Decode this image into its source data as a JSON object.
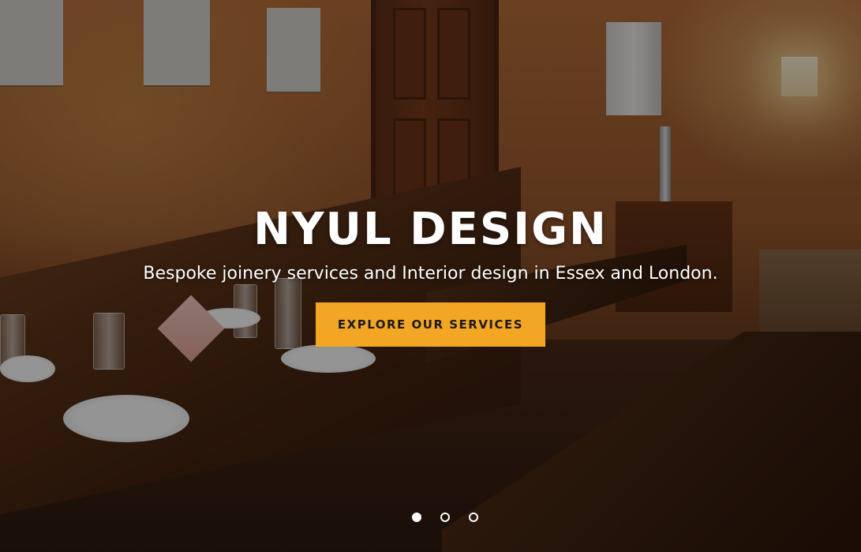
{
  "hero": {
    "title": "NYUL DESIGN",
    "subtitle": "Bespoke joinery services and Interior design in Essex and London.",
    "cta_label": "EXPLORE OUR SERVICES",
    "background_image": "restaurant-dining-room-photo"
  },
  "slider": {
    "slide_count": 3,
    "active_index": 0
  },
  "colors": {
    "cta_background": "#f3a624",
    "text": "#ffffff"
  }
}
